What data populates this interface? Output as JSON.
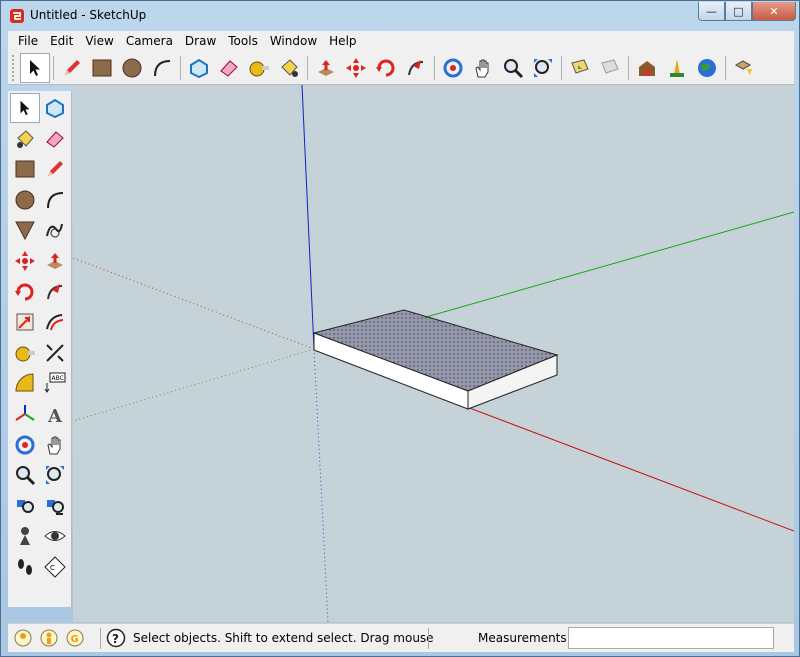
{
  "window": {
    "title": "Untitled - SketchUp",
    "buttons": {
      "minimize": "—",
      "maximize": "□",
      "close": "✕"
    }
  },
  "menu": [
    {
      "label": "File"
    },
    {
      "label": "Edit"
    },
    {
      "label": "View"
    },
    {
      "label": "Camera"
    },
    {
      "label": "Draw"
    },
    {
      "label": "Tools"
    },
    {
      "label": "Window"
    },
    {
      "label": "Help"
    }
  ],
  "toolbar": {
    "icons": [
      "select-icon",
      "pencil-icon",
      "rectangle-icon",
      "circle-icon",
      "arc-icon",
      "make-component-icon",
      "eraser-icon",
      "tape-measure-icon",
      "paint-bucket-icon",
      "push-pull-icon",
      "move-icon",
      "rotate-icon",
      "follow-me-icon",
      "orbit-icon",
      "pan-icon",
      "zoom-icon",
      "zoom-extents-icon",
      "previous-view-icon",
      "next-view-icon",
      "warehouse-icon",
      "extension-icon",
      "google-earth-icon",
      "share-icon"
    ]
  },
  "status": {
    "message": "Select objects. Shift to extend select. Drag mouse",
    "measurements_label": "Measurements",
    "measurements_value": ""
  },
  "colors": {
    "viewport_bg": "#c5d2d7",
    "axis_red": "#cc1111",
    "axis_green": "#11aa11",
    "axis_blue": "#1122cc",
    "box_top": "#8a8fa3",
    "box_side": "#ffffff"
  }
}
